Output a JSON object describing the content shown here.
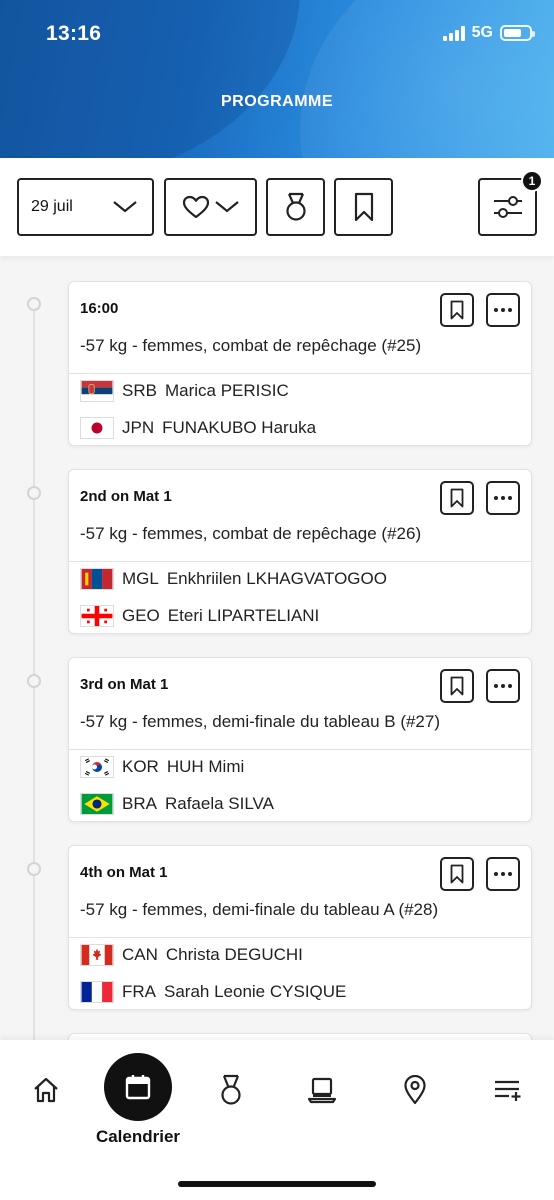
{
  "status_bar": {
    "time": "13:16",
    "network": "5G",
    "battery_level": 0.7
  },
  "header": {
    "title": "PROGRAMME"
  },
  "filters": {
    "date_value": "29 juil",
    "filter_count": "1",
    "icons": [
      "chevron-down-icon",
      "heart-icon",
      "medal-icon",
      "bookmark-icon",
      "sliders-icon"
    ]
  },
  "cards": [
    {
      "time": "16:00",
      "event": "-57 kg - femmes, combat de repêchage (#25)",
      "athletes": [
        {
          "flag": "srb",
          "code": "SRB",
          "name": "Marica PERISIC"
        },
        {
          "flag": "jpn",
          "code": "JPN",
          "name": "FUNAKUBO Haruka"
        }
      ]
    },
    {
      "time": "2nd on Mat 1",
      "event": "-57 kg - femmes, combat de repêchage (#26)",
      "athletes": [
        {
          "flag": "mgl",
          "code": "MGL",
          "name": "Enkhriilen LKHAGVATOGOO"
        },
        {
          "flag": "geo",
          "code": "GEO",
          "name": "Eteri LIPARTELIANI"
        }
      ]
    },
    {
      "time": "3rd on Mat 1",
      "event": "-57 kg - femmes, demi-finale du tableau B (#27)",
      "athletes": [
        {
          "flag": "kor",
          "code": "KOR",
          "name": "HUH Mimi"
        },
        {
          "flag": "bra",
          "code": "BRA",
          "name": "Rafaela SILVA"
        }
      ]
    },
    {
      "time": "4th on Mat 1",
      "event": "-57 kg - femmes, demi-finale du tableau A (#28)",
      "athletes": [
        {
          "flag": "can",
          "code": "CAN",
          "name": "Christa DEGUCHI"
        },
        {
          "flag": "fra",
          "code": "FRA",
          "name": "Sarah Leonie CYSIQUE"
        }
      ]
    }
  ],
  "bottom_nav": {
    "active_label": "Calendrier",
    "items": [
      "home-icon",
      "calendar-icon",
      "medal-icon",
      "laptop-icon",
      "map-pin-icon",
      "playlist-add-icon"
    ]
  }
}
